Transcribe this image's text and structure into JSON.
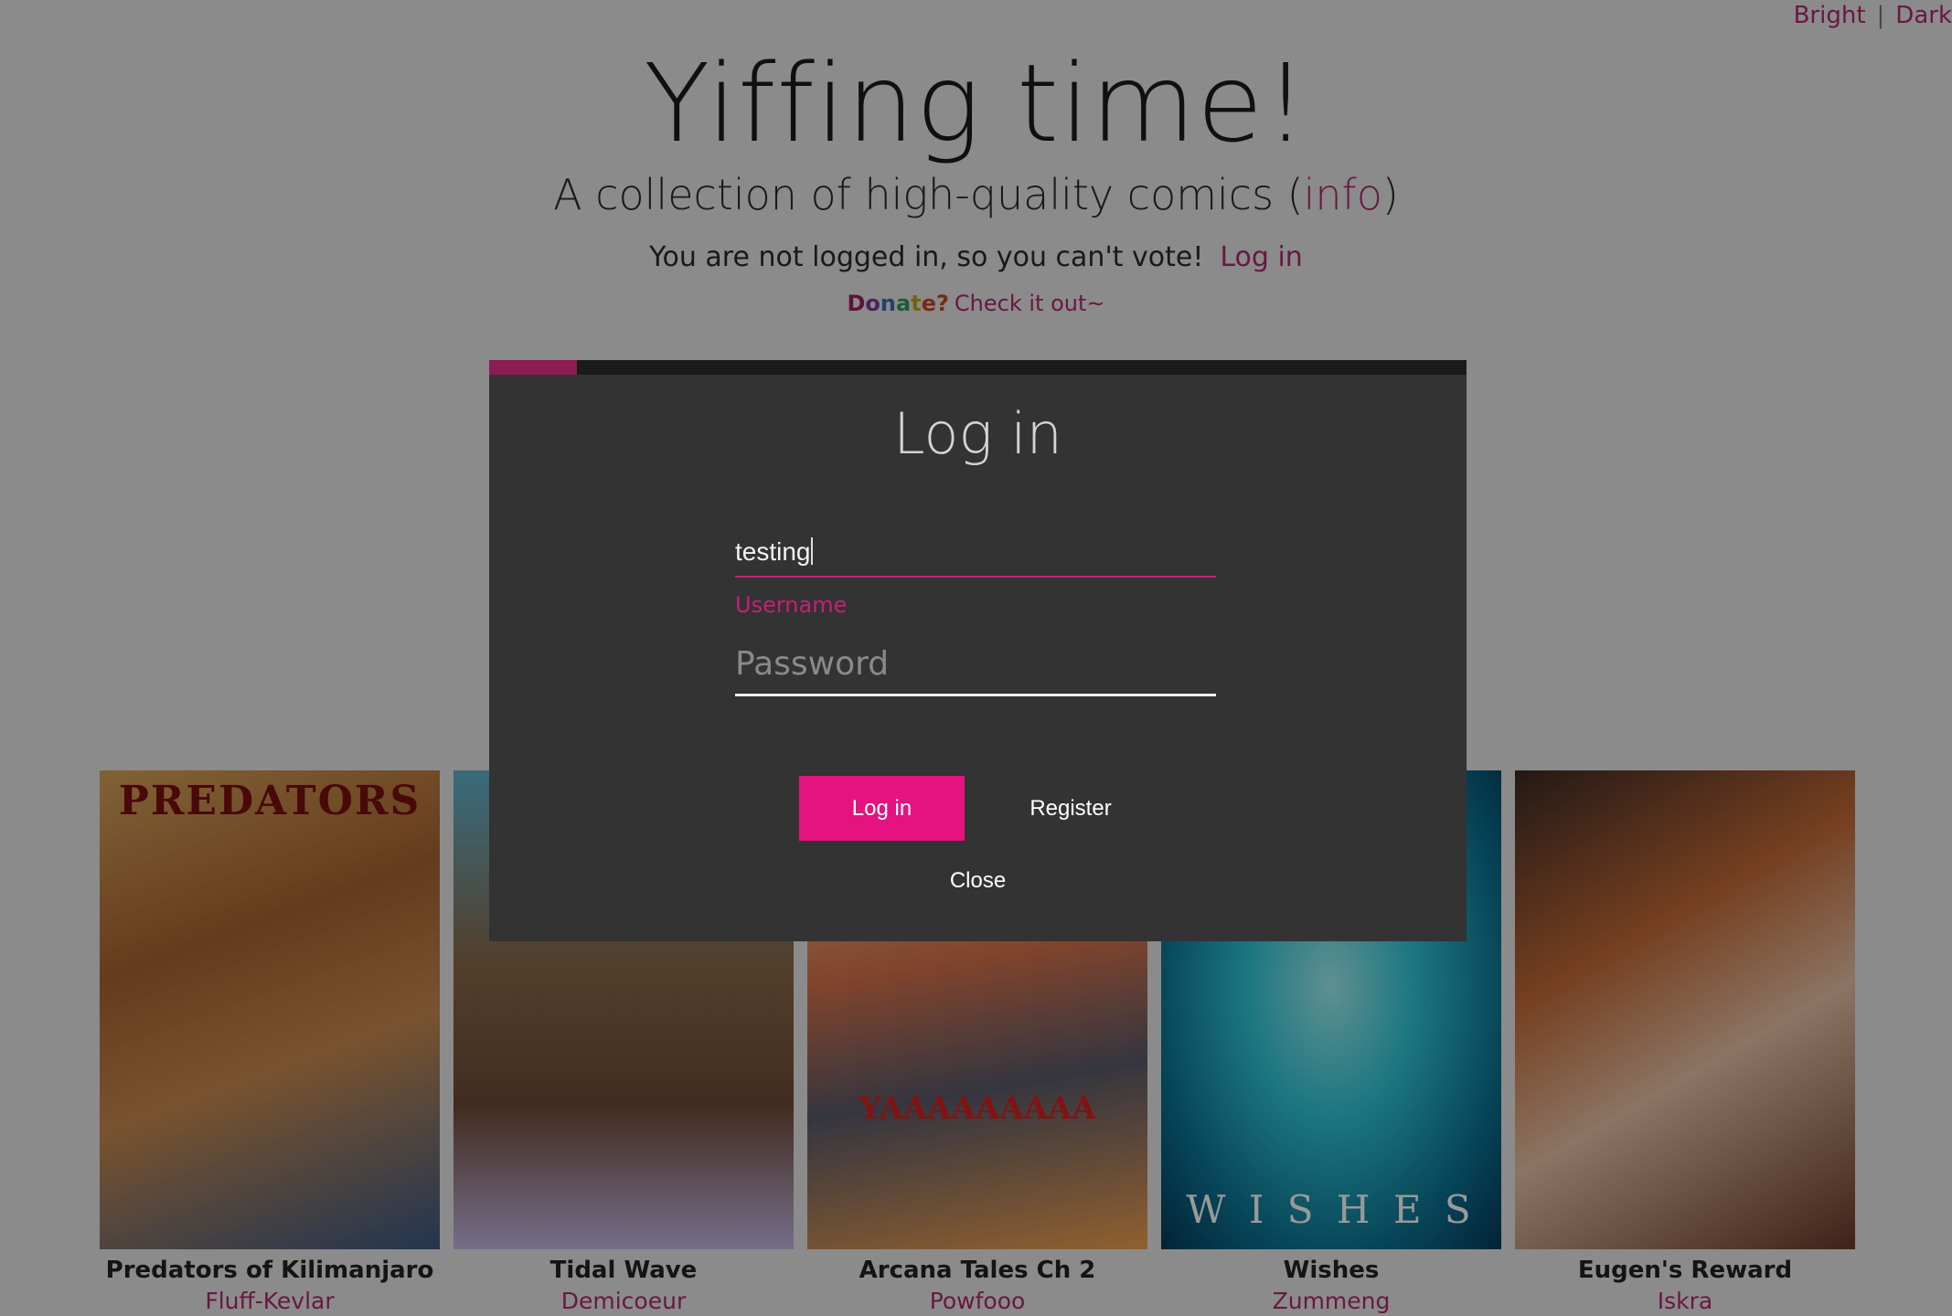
{
  "theme_switch": {
    "bright": "Bright",
    "separator": "|",
    "dark": "Dark"
  },
  "header": {
    "title": "Yiffing time!",
    "subtitle_text": "A collection of high-quality comics (",
    "subtitle_link": "info",
    "subtitle_close": ")",
    "login_notice": "You are not logged in, so you can't vote!",
    "login_link": "Log in",
    "donate_letters": [
      "D",
      "o",
      "n",
      "a",
      "t",
      "e?"
    ],
    "donate_check": "Check it out~"
  },
  "comics": [
    {
      "title": "Predators of Kilimanjaro",
      "author": "Fluff-Kevlar",
      "cover_text": "PREDATORS"
    },
    {
      "title": "Tidal Wave",
      "author": "Demicoeur",
      "cover_text": ""
    },
    {
      "title": "Arcana Tales Ch 2",
      "author": "Powfooo",
      "cover_text": "YAAAAAAAAA"
    },
    {
      "title": "Wishes",
      "author": "Zummeng",
      "cover_text": "W I S H E S"
    },
    {
      "title": "Eugen's Reward",
      "author": "Iskra",
      "cover_text": ""
    }
  ],
  "modal": {
    "title": "Log in",
    "username_value": "testing",
    "username_label": "Username",
    "password_placeholder": "Password",
    "login_button": "Log in",
    "register_button": "Register",
    "close_button": "Close",
    "progress_fraction": 0.09
  },
  "colors": {
    "accent": "#e5137f",
    "link": "#b0286e",
    "modal_bg": "#333333"
  }
}
